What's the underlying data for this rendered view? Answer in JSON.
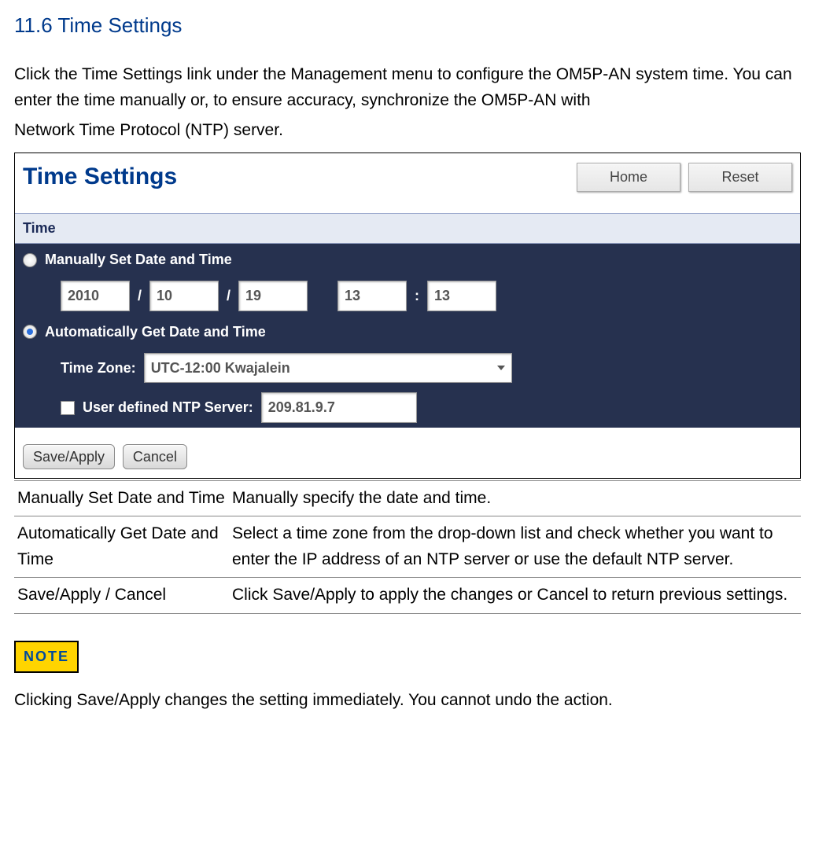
{
  "heading": "11.6 Time Settings",
  "intro_lines": [
    "Click the Time Settings link under the Management menu to configure the OM5P-AN system time. You can enter the time manually or, to ensure accuracy, synchronize the OM5P-AN with",
    "Network Time Protocol (NTP) server."
  ],
  "panel": {
    "title": "Time Settings",
    "home": "Home",
    "reset": "Reset",
    "section": "Time",
    "manual_label": "Manually Set Date and Time",
    "auto_label": "Automatically Get Date and Time",
    "tz_label": "Time Zone:",
    "ntp_label": "User defined NTP Server:",
    "date": {
      "y": "2010",
      "m": "10",
      "d": "19"
    },
    "time": {
      "h": "13",
      "min": "13"
    },
    "tz_value": "UTC-12:00 Kwajalein",
    "ntp_value": "209.81.9.7",
    "save": "Save/Apply",
    "cancel": "Cancel",
    "selected": "auto",
    "ntp_checked": false,
    "separators": {
      "slash": "/",
      "colon": ":"
    }
  },
  "table": [
    {
      "label": "Manually Set Date and Time",
      "desc": "Manually specify the date and time."
    },
    {
      "label": "Automatically Get Date and Time",
      "desc": "Select a time zone from the drop-down  list and check whether you want to enter the IP address of an NTP server or use the default NTP server."
    },
    {
      "label": "Save/Apply / Cancel",
      "desc": "Click Save/Apply to apply the changes or Cancel to return previous settings."
    }
  ],
  "note_badge": "NOTE",
  "note_text": "Clicking Save/Apply changes the setting immediately. You cannot undo the action."
}
